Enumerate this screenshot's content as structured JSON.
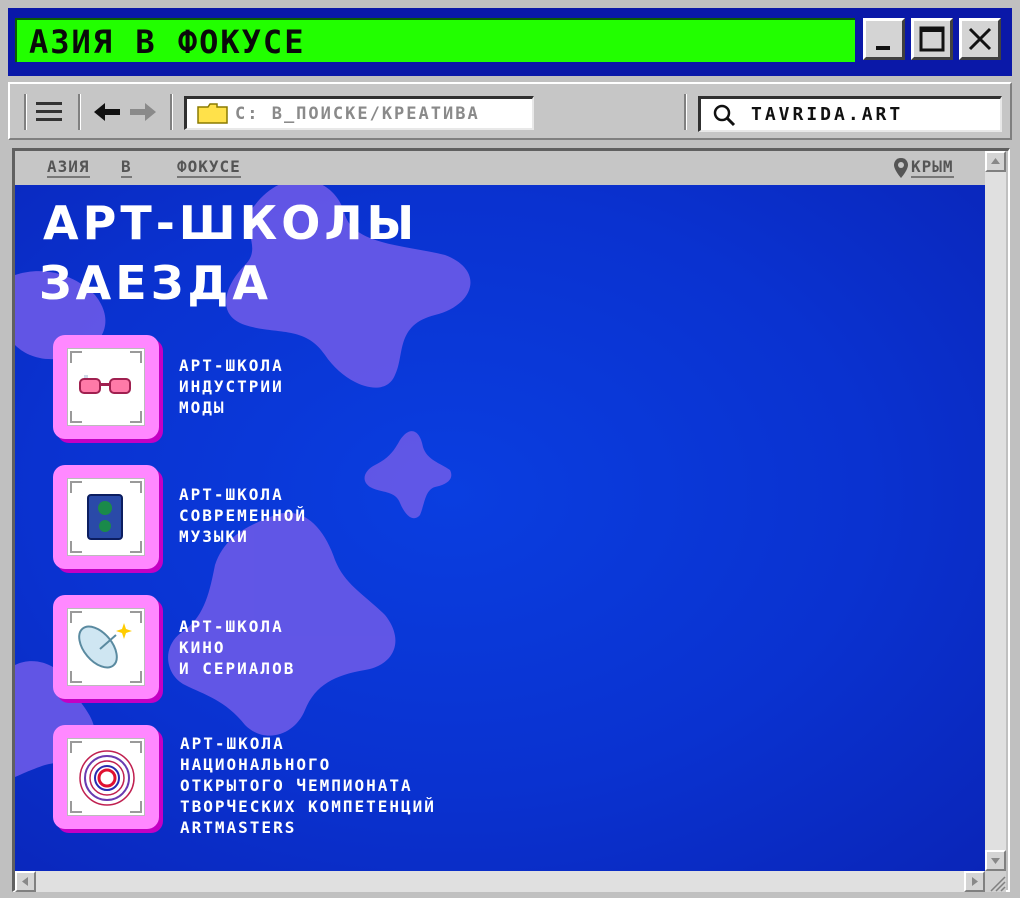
{
  "window": {
    "title": "АЗИЯ В ФОКУСЕ",
    "accent_color": "#22ff00",
    "titlebar_color": "#0a18a8"
  },
  "toolbar": {
    "path": "C: В_ПОИСКЕ/КРЕАТИВА",
    "search_value": "TAVRIDA.ART"
  },
  "nav": {
    "links": [
      "АЗИЯ",
      "В",
      "ФОКУСЕ"
    ],
    "location": "КРЫМ"
  },
  "page": {
    "headline_line1": "АРТ-ШКОЛЫ",
    "headline_line2": "ЗАЕЗДА",
    "background_color": "#0a32d0",
    "card_color": "#ff88ff",
    "schools": [
      {
        "label": "АРТ-ШКОЛА\nИНДУСТРИИ\nМОДЫ",
        "icon": "sunglasses-icon"
      },
      {
        "label": "АРТ-ШКОЛА\nСОВРЕМЕННОЙ\nМУЗЫКИ",
        "icon": "speaker-icon"
      },
      {
        "label": "АРТ-ШКОЛА\nКИНО\nИ СЕРИАЛОВ",
        "icon": "satellite-dish-icon"
      },
      {
        "label": "АРТ-ШКОЛА\nНАЦИОНАЛЬНОГО\nОТКРЫТОГО ЧЕМПИОНАТА\nТВОРЧЕСКИХ КОМПЕТЕНЦИЙ\nARTMASTERS",
        "icon": "target-rings-icon"
      }
    ]
  }
}
